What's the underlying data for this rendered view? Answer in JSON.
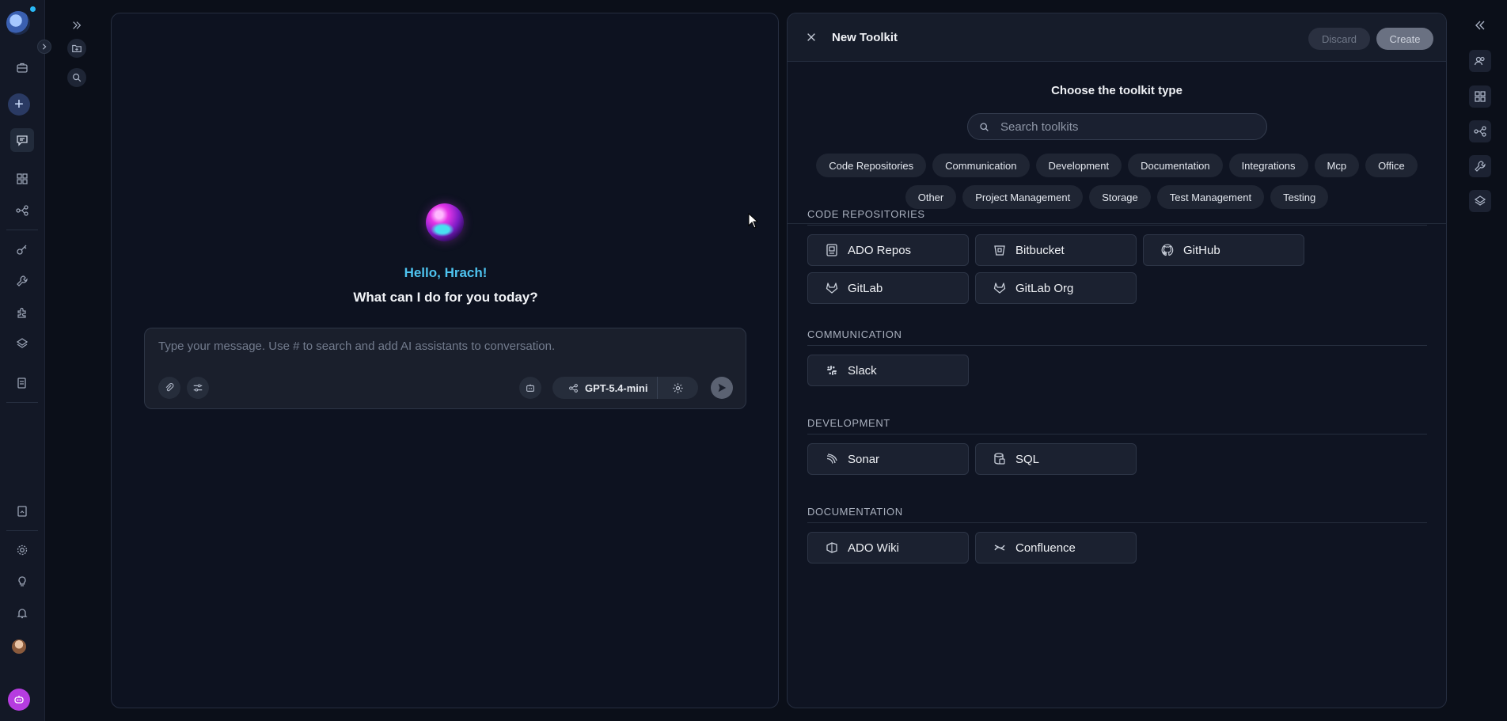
{
  "rail": {
    "icons": [
      "logo-icon",
      "briefcase-icon",
      "plus-icon",
      "chat-icon",
      "grid-icon",
      "workflow-icon",
      "key-icon",
      "wrench-icon",
      "puzzle-icon",
      "layers-icon",
      "document-icon",
      "report-icon",
      "settings-icon",
      "lightbulb-icon",
      "bell-icon",
      "avatar",
      "bot-icon"
    ]
  },
  "chat": {
    "greeting": "Hello, Hrach!",
    "prompt": "What can I do for you today?",
    "input_placeholder": "Type your message. Use # to search and add AI assistants to conversation.",
    "model": "GPT-5.4-mini"
  },
  "toolkit": {
    "title": "New Toolkit",
    "discard_label": "Discard",
    "create_label": "Create",
    "subtitle": "Choose the toolkit type",
    "search_placeholder": "Search toolkits",
    "filters_row1": [
      "Code Repositories",
      "Communication",
      "Development",
      "Documentation",
      "Integrations",
      "Mcp",
      "Office"
    ],
    "filters_row2": [
      "Other",
      "Project Management",
      "Storage",
      "Test Management",
      "Testing"
    ],
    "sections": [
      {
        "title": "CODE REPOSITORIES",
        "items": [
          {
            "label": "ADO Repos",
            "icon": "ado-repos-icon"
          },
          {
            "label": "Bitbucket",
            "icon": "bitbucket-icon"
          },
          {
            "label": "GitHub",
            "icon": "github-icon"
          },
          {
            "label": "GitLab",
            "icon": "gitlab-icon"
          },
          {
            "label": "GitLab Org",
            "icon": "gitlab-org-icon"
          }
        ]
      },
      {
        "title": "COMMUNICATION",
        "items": [
          {
            "label": "Slack",
            "icon": "slack-icon"
          }
        ]
      },
      {
        "title": "DEVELOPMENT",
        "items": [
          {
            "label": "Sonar",
            "icon": "sonar-icon"
          },
          {
            "label": "SQL",
            "icon": "sql-icon"
          }
        ]
      },
      {
        "title": "DOCUMENTATION",
        "items": [
          {
            "label": "ADO Wiki",
            "icon": "ado-wiki-icon"
          },
          {
            "label": "Confluence",
            "icon": "confluence-icon"
          }
        ]
      }
    ]
  },
  "colors": {
    "accent": "#4ec3ef",
    "background": "#0b0f19",
    "panel": "#0f1422"
  }
}
